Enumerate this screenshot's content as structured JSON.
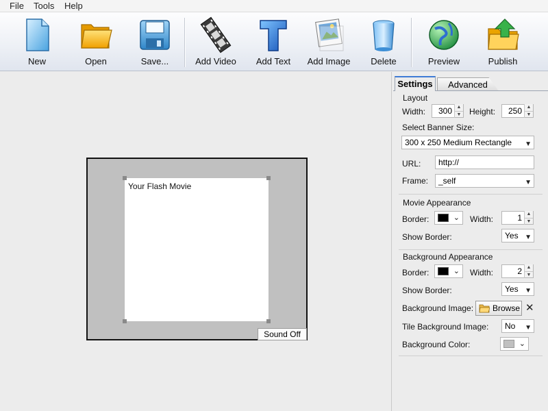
{
  "menu": [
    "File",
    "Tools",
    "Help"
  ],
  "toolbar": {
    "new": "New",
    "open": "Open",
    "save": "Save...",
    "add_video": "Add Video",
    "add_text": "Add Text",
    "add_image": "Add Image",
    "delete": "Delete",
    "preview": "Preview",
    "publish": "Publish"
  },
  "canvas": {
    "movie_text": "Your Flash Movie",
    "sound_button": "Sound Off",
    "stage_bg_color": "#c0c0c0"
  },
  "tabs": {
    "settings": "Settings",
    "advanced": "Advanced"
  },
  "layout": {
    "title": "Layout",
    "width_label": "Width:",
    "width_value": "300",
    "height_label": "Height:",
    "height_value": "250",
    "banner_size_label": "Select Banner Size:",
    "banner_size_value": "300 x 250  Medium Rectangle",
    "url_label": "URL:",
    "url_value": "http://",
    "frame_label": "Frame:",
    "frame_value": "_self"
  },
  "movie_appearance": {
    "title": "Movie Appearance",
    "border_label": "Border:",
    "border_color": "#000000",
    "width_label": "Width:",
    "width_value": "1",
    "show_border_label": "Show Border:",
    "show_border_value": "Yes"
  },
  "background_appearance": {
    "title": "Background Appearance",
    "border_label": "Border:",
    "border_color": "#000000",
    "width_label": "Width:",
    "width_value": "2",
    "show_border_label": "Show Border:",
    "show_border_value": "Yes",
    "bg_image_label": "Background Image:",
    "browse_label": "Browse",
    "tile_label": "Tile Background Image:",
    "tile_value": "No",
    "bg_color_label": "Background Color:",
    "bg_color": "#c0c0c0"
  }
}
